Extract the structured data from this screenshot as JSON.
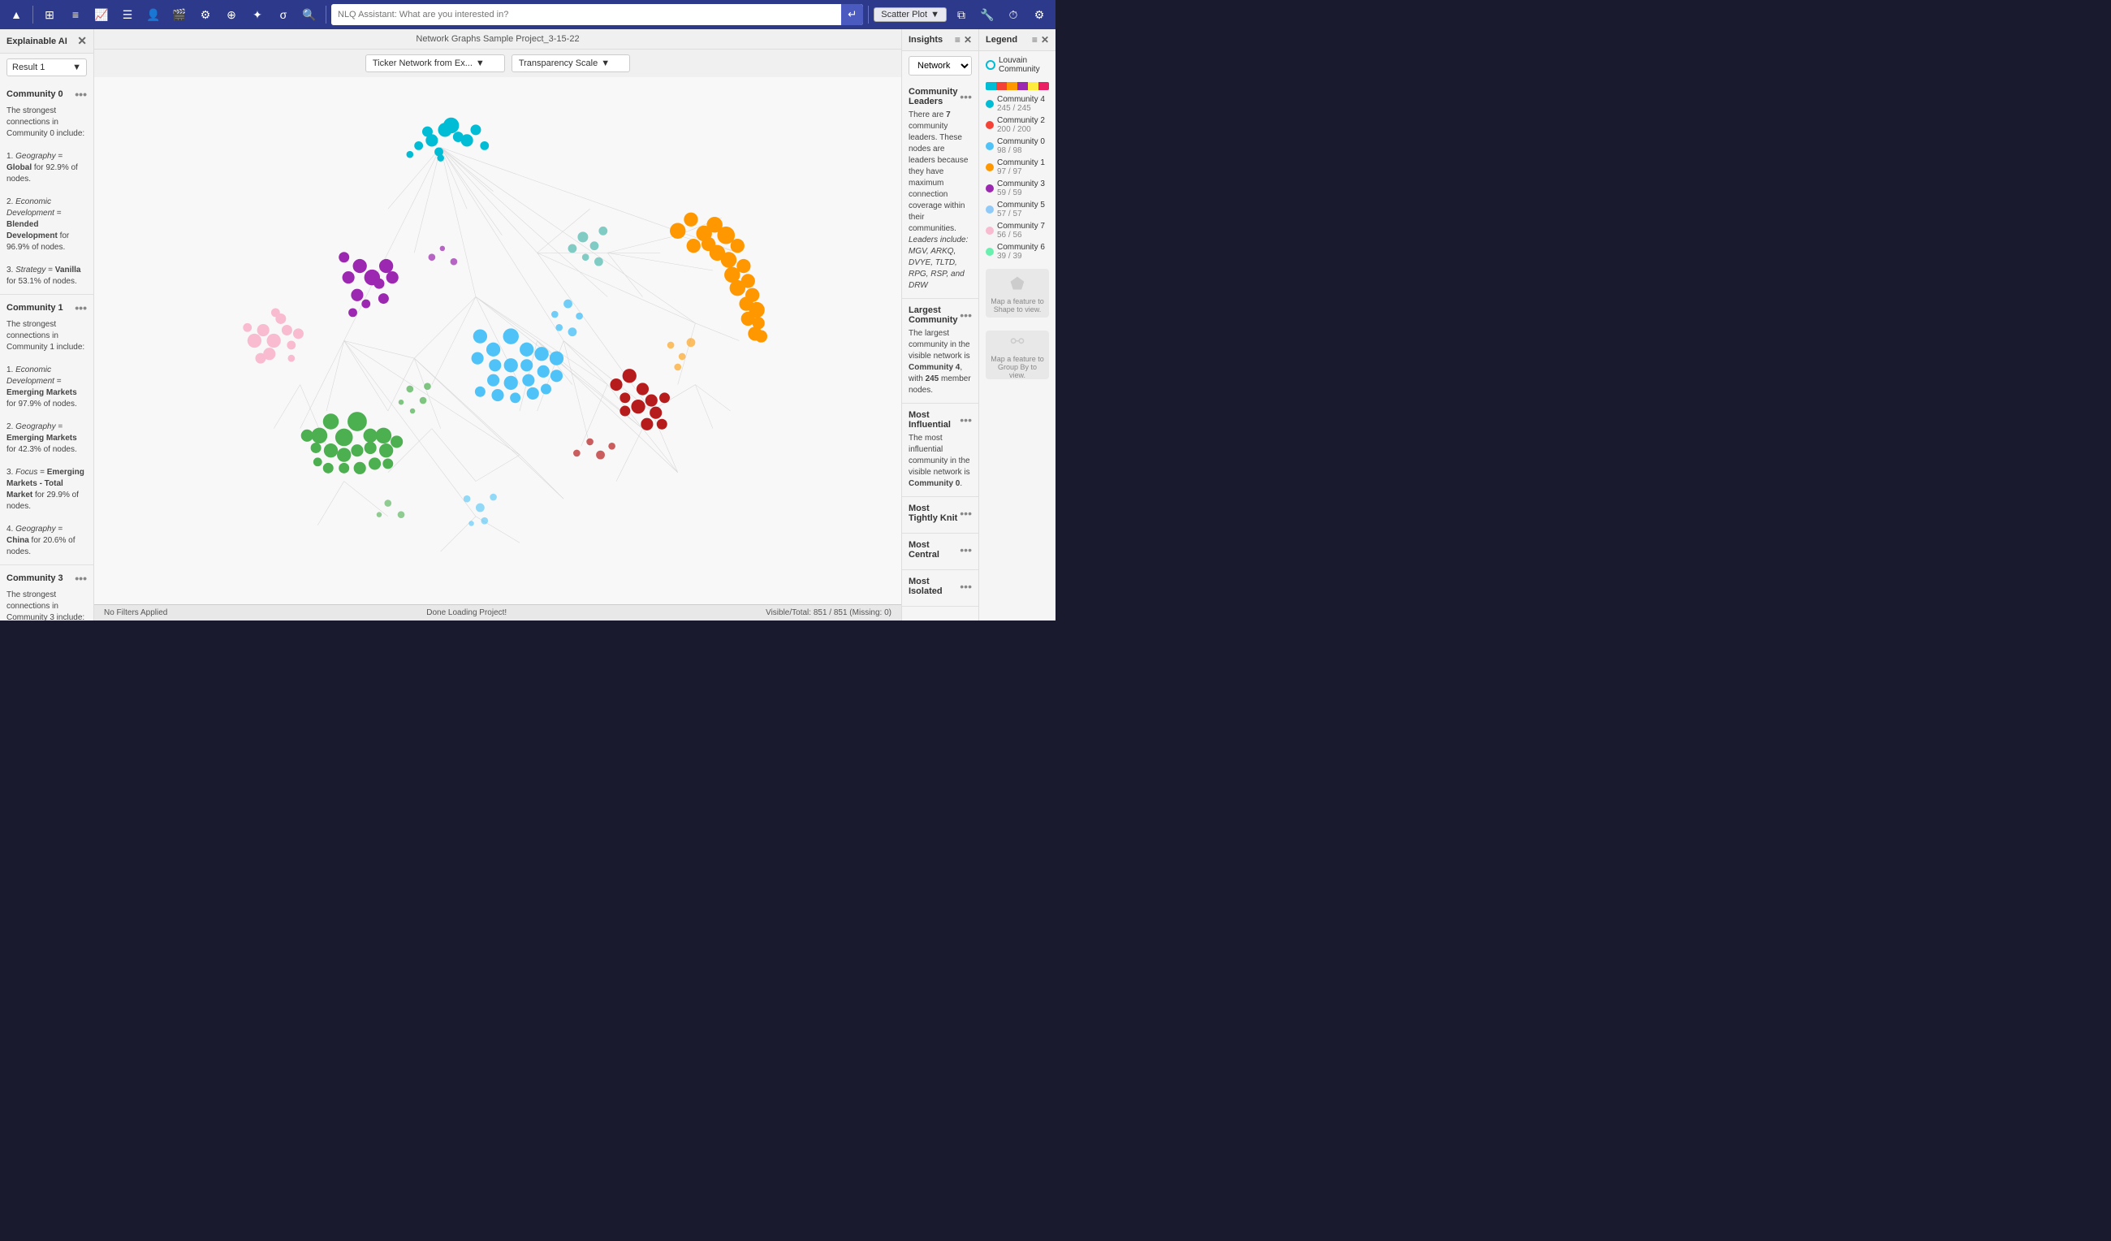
{
  "toolbar": {
    "search_placeholder": "NLQ Assistant: What are you interested in?",
    "scatter_label": "Scatter Plot",
    "icons": [
      "▲",
      "⊞",
      "≡",
      "📈",
      "☰",
      "👤",
      "🎬",
      "⚙",
      "⊕",
      "✦",
      "σ",
      "🔍"
    ]
  },
  "center": {
    "project_title": "Network Graphs Sample Project_3-15-22",
    "dropdown1_label": "Ticker Network from Ex...",
    "dropdown2_label": "Transparency Scale",
    "status_left": "No Filters Applied",
    "status_center": "Done Loading Project!",
    "status_right": "Visible/Total: 851 / 851 (Missing: 0)"
  },
  "left_panel": {
    "title": "Explainable AI",
    "result_label": "Result 1",
    "communities": [
      {
        "name": "Community 0",
        "text_parts": [
          {
            "type": "plain",
            "text": "The strongest connections in Community 0 include:"
          },
          {
            "type": "plain",
            "text": ""
          },
          {
            "type": "plain",
            "text": "1. "
          },
          {
            "type": "italic",
            "text": "Geography"
          },
          {
            "type": "plain",
            "text": " = "
          },
          {
            "type": "bold",
            "text": "Global"
          },
          {
            "type": "plain",
            "text": " for 92.9% of nodes."
          },
          {
            "type": "plain",
            "text": ""
          },
          {
            "type": "plain",
            "text": "2. "
          },
          {
            "type": "italic",
            "text": "Economic Development"
          },
          {
            "type": "plain",
            "text": " = "
          },
          {
            "type": "bold",
            "text": "Blended Development"
          },
          {
            "type": "plain",
            "text": " for 96.9% of nodes."
          },
          {
            "type": "plain",
            "text": ""
          },
          {
            "type": "plain",
            "text": "3. "
          },
          {
            "type": "italic",
            "text": "Strategy"
          },
          {
            "type": "plain",
            "text": " = "
          },
          {
            "type": "bold",
            "text": "Vanilla"
          },
          {
            "type": "plain",
            "text": " for 53.1% of nodes."
          }
        ]
      },
      {
        "name": "Community 1",
        "text_parts": [
          {
            "type": "plain",
            "text": "The strongest connections in Community 1 include:"
          },
          {
            "type": "plain",
            "text": ""
          },
          {
            "type": "plain",
            "text": "1. "
          },
          {
            "type": "italic",
            "text": "Economic Development"
          },
          {
            "type": "plain",
            "text": " = "
          },
          {
            "type": "bold",
            "text": "Emerging Markets"
          },
          {
            "type": "plain",
            "text": " for 97.9% of nodes."
          },
          {
            "type": "plain",
            "text": ""
          },
          {
            "type": "plain",
            "text": "2. "
          },
          {
            "type": "italic",
            "text": "Geography"
          },
          {
            "type": "plain",
            "text": " = "
          },
          {
            "type": "bold",
            "text": "Emerging Markets"
          },
          {
            "type": "plain",
            "text": " for 42.3% of nodes."
          },
          {
            "type": "plain",
            "text": ""
          },
          {
            "type": "plain",
            "text": "3. "
          },
          {
            "type": "italic",
            "text": "Focus"
          },
          {
            "type": "plain",
            "text": " = "
          },
          {
            "type": "bold",
            "text": "Emerging Markets - Total Market"
          },
          {
            "type": "plain",
            "text": " for 29.9% of nodes."
          },
          {
            "type": "plain",
            "text": ""
          },
          {
            "type": "plain",
            "text": "4. "
          },
          {
            "type": "italic",
            "text": "Geography"
          },
          {
            "type": "plain",
            "text": " = "
          },
          {
            "type": "bold",
            "text": "China"
          },
          {
            "type": "plain",
            "text": " for 20.6% of nodes."
          }
        ]
      },
      {
        "name": "Community 3",
        "text_parts": [
          {
            "type": "plain",
            "text": "The strongest connections in Community 3 include:"
          }
        ]
      }
    ]
  },
  "insights": {
    "title": "Insights",
    "network_label": "Network",
    "cards": [
      {
        "title": "Community Leaders",
        "text": "There are 7 community leaders. These nodes are leaders because they have maximum connection coverage within their communities. Leaders include: MGV, ARKQ, DVYE, TLTD, RPG, RSP, and DRW"
      },
      {
        "title": "Largest Community",
        "text": "The largest community in the visible network is Community 4, with 245 member nodes."
      },
      {
        "title": "Most Influential",
        "text": "The most influential community in the visible network is Community 0."
      },
      {
        "title": "Most Tightly Knit",
        "text": ""
      },
      {
        "title": "Most Central",
        "text": ""
      },
      {
        "title": "Most Isolated",
        "text": ""
      }
    ]
  },
  "legend": {
    "title": "Legend",
    "louvain_label": "Louvain Community",
    "color_segments": [
      "#00bcd4",
      "#f44336",
      "#ff9800",
      "#9c27b0",
      "#ffeb3b",
      "#e91e63"
    ],
    "communities": [
      {
        "name": "Community 4",
        "sub": "245 / 245",
        "color": "#00bcd4"
      },
      {
        "name": "Community 2",
        "sub": "200 / 200",
        "color": "#f44336"
      },
      {
        "name": "Community 0",
        "sub": "98 / 98",
        "color": "#00bcd4"
      },
      {
        "name": "Community 1",
        "sub": "97 / 97",
        "color": "#ff9800"
      },
      {
        "name": "Community 3",
        "sub": "59 / 59",
        "color": "#9c27b0"
      },
      {
        "name": "Community 5",
        "sub": "57 / 57",
        "color": "#90caf9"
      },
      {
        "name": "Community 7",
        "sub": "56 / 56",
        "color": "#f8bbd0"
      },
      {
        "name": "Community 6",
        "sub": "39 / 39",
        "color": "#69f0ae"
      }
    ],
    "shape_placeholder": "Map a feature to Shape to view.",
    "group_placeholder": "Map a feature to Group By to view."
  }
}
